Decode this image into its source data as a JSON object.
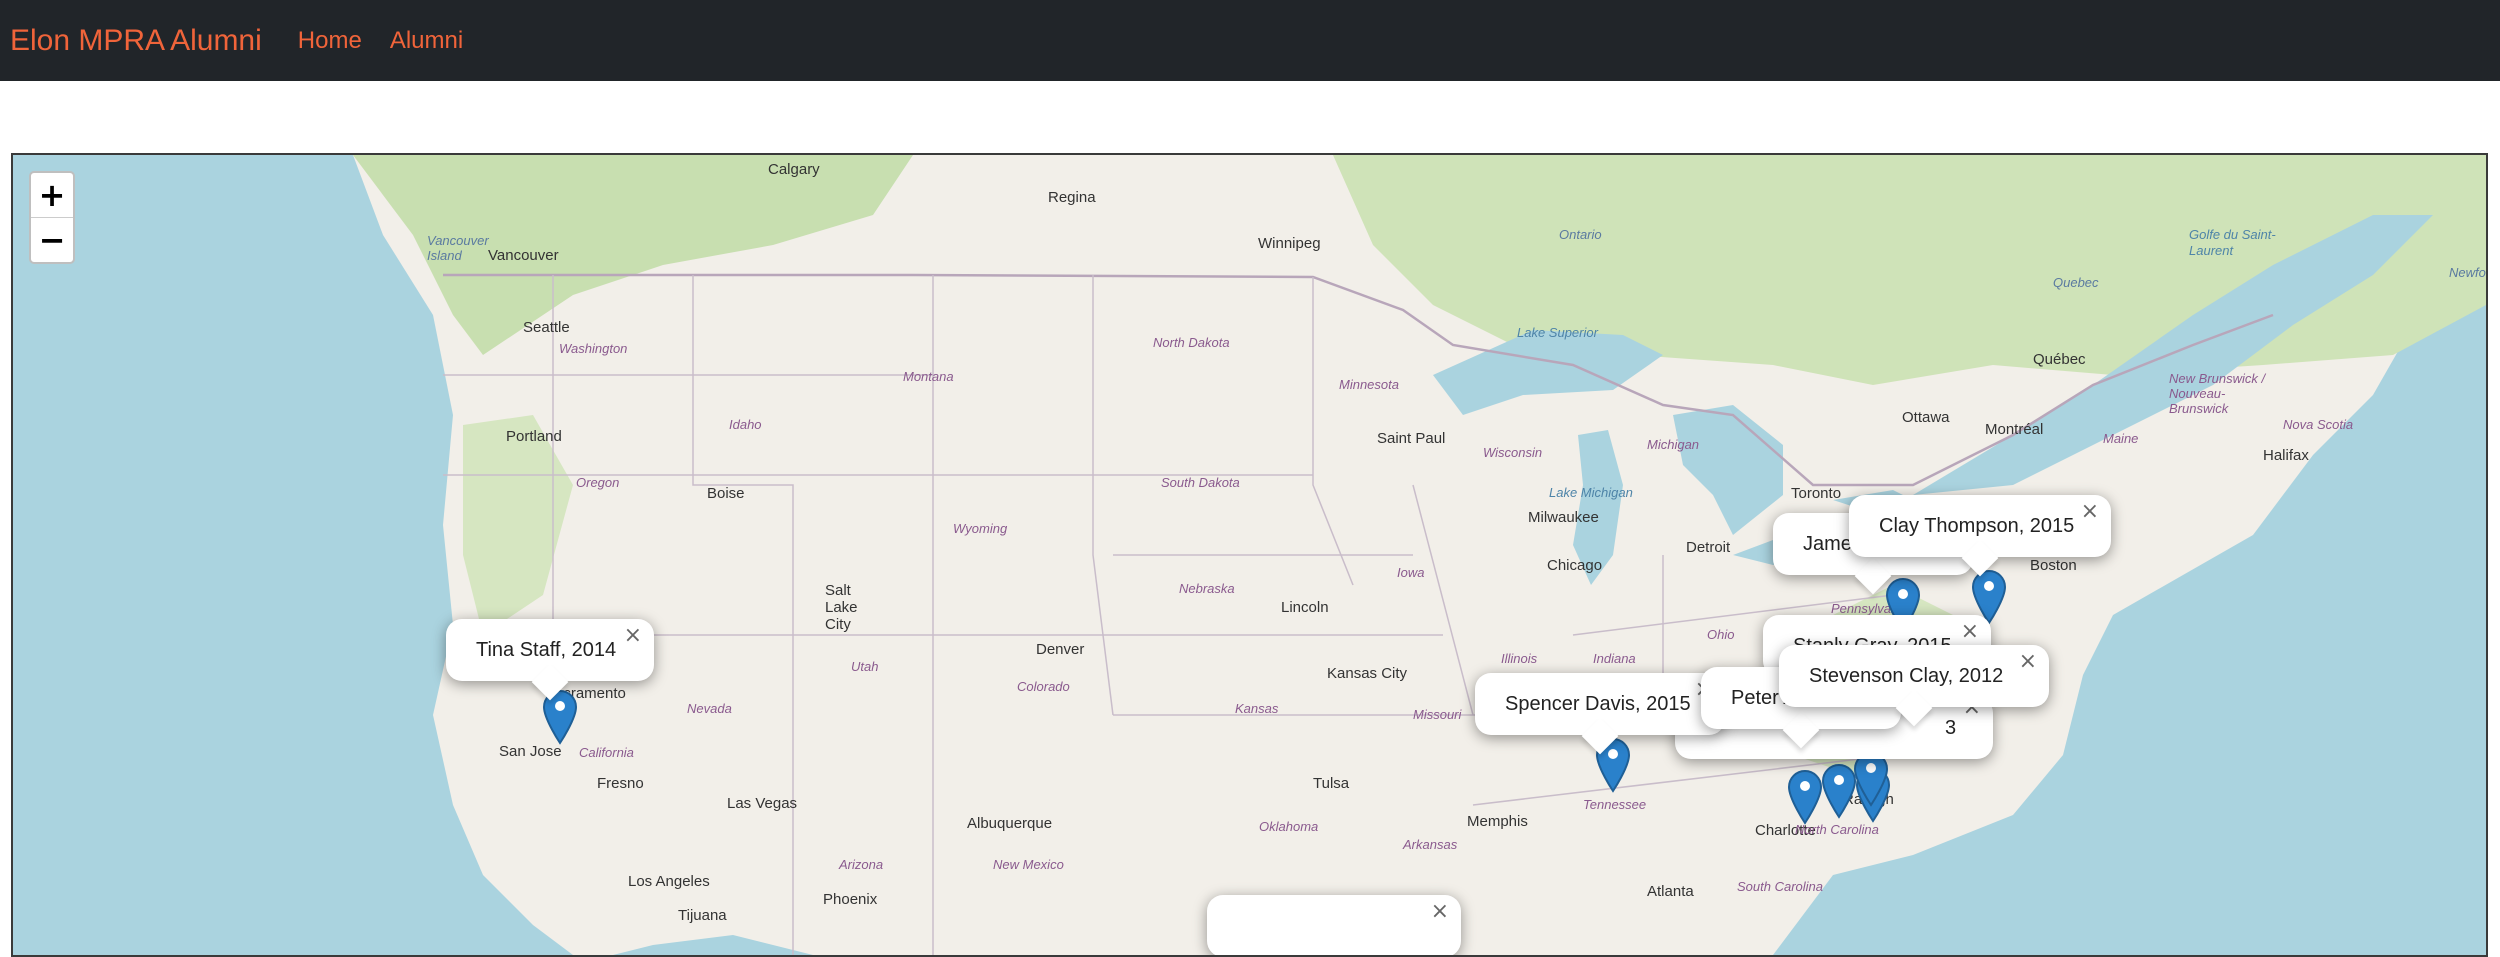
{
  "navbar": {
    "brand": "Elon MPRA Alumni",
    "links": [
      "Home",
      "Alumni"
    ]
  },
  "map": {
    "zoom_in_label": "+",
    "zoom_out_label": "−",
    "close_symbol": "×",
    "cities": [
      "Calgary",
      "Regina",
      "Winnipeg",
      "Vancouver",
      "Seattle",
      "Portland",
      "Boise",
      "Salt Lake City",
      "Denver",
      "Saint Paul",
      "Lincoln",
      "Kansas City",
      "Chicago",
      "Milwaukee",
      "Detroit",
      "Toronto",
      "Ottawa",
      "Montréal",
      "Québec",
      "Boston",
      "Halifax",
      "Tulsa",
      "Memphis",
      "Charlotte",
      "Raleigh",
      "Atlanta",
      "Las Vegas",
      "Albuquerque",
      "Phoenix",
      "Los Angeles",
      "Fresno",
      "San Jose",
      "Sacramento",
      "Tijuana"
    ],
    "regions": [
      "Washington",
      "Oregon",
      "Idaho",
      "Montana",
      "North Dakota",
      "South Dakota",
      "Minnesota",
      "Wyoming",
      "Nebraska",
      "Iowa",
      "Wisconsin",
      "Michigan",
      "Utah",
      "Colorado",
      "Nevada",
      "California",
      "Kansas",
      "Missouri",
      "Illinois",
      "Indiana",
      "Ohio",
      "Pennsylvania",
      "Tennessee",
      "North Carolina",
      "South Carolina",
      "Oklahoma",
      "Arkansas",
      "Arizona",
      "New Mexico",
      "Maine",
      "New Brunswick / Nouveau-Brunswick",
      "Nova Scotia"
    ],
    "provinces": [
      "Ontario",
      "Quebec",
      "Vancouver Island",
      "Newfo"
    ],
    "water": [
      "Lake Superior",
      "Lake Michigan",
      "Golfe du Saint-Laurent"
    ],
    "popups": [
      {
        "name": "Tina Staff, 2014"
      },
      {
        "name": "Spencer Davis, 2015"
      },
      {
        "name": "Jame"
      },
      {
        "name": "Clay Thompson, 2015"
      },
      {
        "name": "Peter A"
      },
      {
        "name": "Stevenson Clay, 2012"
      },
      {
        "name": "Stanly Gray, 2015"
      },
      {
        "name": "3"
      }
    ],
    "colors": {
      "land": "#f2efe9",
      "water": "#aad3df",
      "forest": "#c8dfb0",
      "marker": "#2a81cb",
      "accent": "#f0643a"
    }
  }
}
